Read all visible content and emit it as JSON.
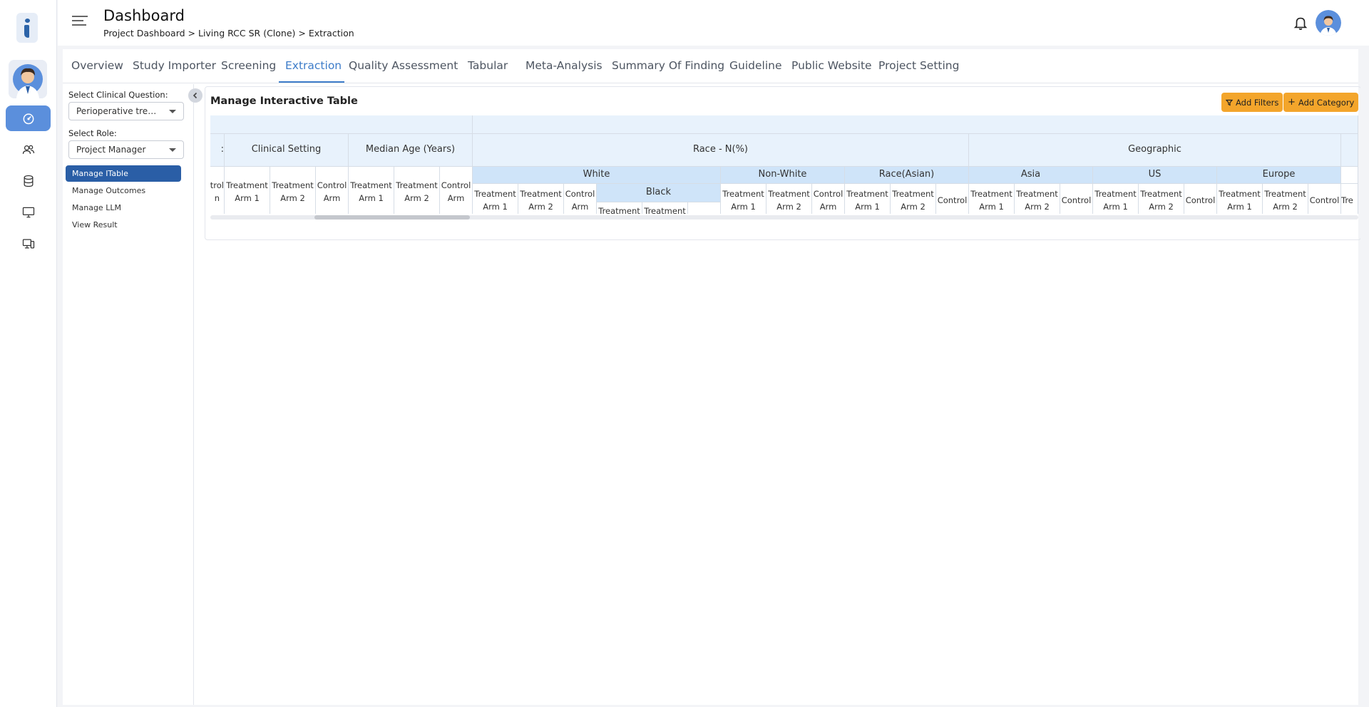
{
  "header": {
    "title": "Dashboard",
    "breadcrumb": "Project Dashboard > Living RCC SR (Clone) > Extraction"
  },
  "tabs": [
    {
      "label": "Overview"
    },
    {
      "label": "Study Importer"
    },
    {
      "label": "Screening"
    },
    {
      "label": "Extraction",
      "active": true
    },
    {
      "label": "Quality Assessment"
    },
    {
      "label": "Tabular"
    },
    {
      "label": "Meta-Analysis"
    },
    {
      "label": "Summary Of Finding"
    },
    {
      "label": "Guideline"
    },
    {
      "label": "Public Website"
    },
    {
      "label": "Project Setting"
    }
  ],
  "left_panel": {
    "question_label": "Select Clinical Question:",
    "question_value": "Perioperative treat...",
    "role_label": "Select Role:",
    "role_value": "Project Manager",
    "nav": [
      {
        "label": "Manage ITable",
        "active": true
      },
      {
        "label": "Manage Outcomes"
      },
      {
        "label": "Manage LLM"
      },
      {
        "label": "View Result"
      }
    ]
  },
  "main": {
    "title": "Manage Interactive Table",
    "add_filters": "Add Filters",
    "add_category": "Add Category"
  },
  "table": {
    "cut_left_top": ":",
    "cut_left_arm": "trol\nn",
    "clinical_setting": "Clinical Setting",
    "median_age": "Median Age (Years)",
    "race": "Race - N(%)",
    "geographic": "Geographic",
    "white": "White",
    "black": "Black",
    "non_white": "Non-White",
    "race_asian": "Race(Asian)",
    "asia": "Asia",
    "us": "US",
    "europe": "Europe",
    "treatment_arm_1": "Treatment\nArm 1",
    "treatment_arm_2": "Treatment\nArm 2",
    "control_arm": "Control\nArm",
    "control": "Control",
    "cut_right": "Tre"
  },
  "colors": {
    "accent": "#3d7cc9",
    "nav_active": "#2a5ea6",
    "button": "#f3a52b",
    "header_light": "#e8f2fc",
    "header_mid": "#cfe4f9"
  }
}
